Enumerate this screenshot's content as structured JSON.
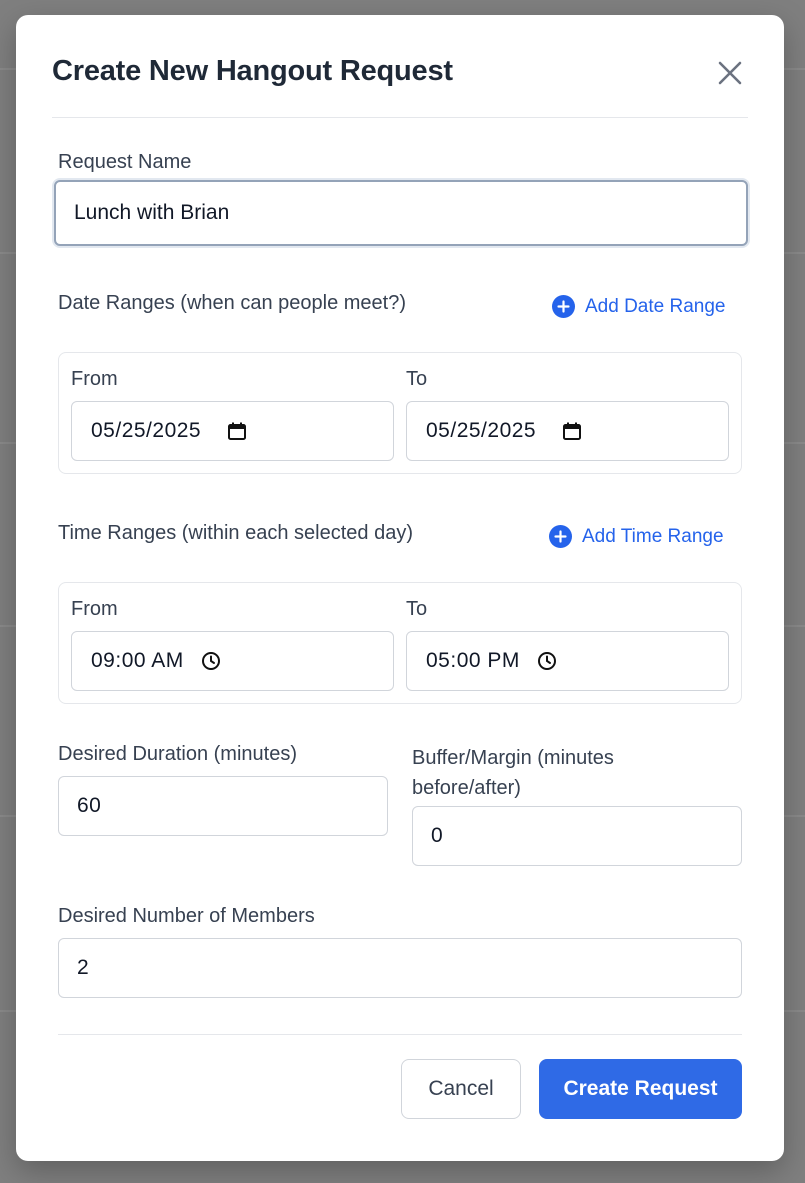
{
  "modal": {
    "title": "Create New Hangout Request"
  },
  "request_name": {
    "label": "Request Name",
    "value": "Lunch with Brian"
  },
  "date_ranges": {
    "label": "Date Ranges (when can people meet?)",
    "add_label": "Add Date Range",
    "from_label": "From",
    "to_label": "To",
    "from_value": "05/25/2025",
    "to_value": "05/25/2025"
  },
  "time_ranges": {
    "label": "Time Ranges (within each selected day)",
    "add_label": "Add Time Range",
    "from_label": "From",
    "to_label": "To",
    "from_value": "09:00 AM",
    "to_value": "05:00 PM"
  },
  "duration": {
    "label": "Desired Duration (minutes)",
    "value": "60"
  },
  "buffer": {
    "label_line1": "Buffer/Margin (minutes",
    "label_line2": "before/after)",
    "value": "0"
  },
  "members": {
    "label": "Desired Number of Members",
    "value": "2"
  },
  "footer": {
    "cancel_label": "Cancel",
    "submit_label": "Create Request"
  },
  "colors": {
    "accent": "#2f6ae6",
    "link": "#2563eb",
    "backdrop": "#7f7f7f"
  },
  "icons": {
    "close": "close-icon",
    "add": "plus-circle-icon",
    "calendar": "calendar-icon",
    "clock": "clock-icon"
  }
}
